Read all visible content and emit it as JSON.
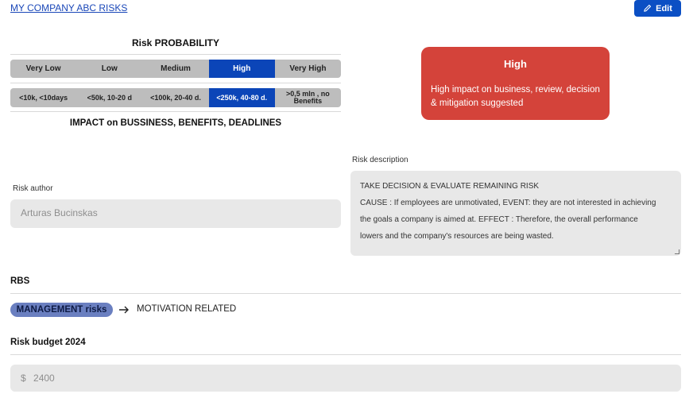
{
  "header": {
    "breadcrumb": "MY COMPANY ABC RISKS",
    "edit_label": "Edit"
  },
  "probability": {
    "title": "Risk PROBABILITY",
    "levels": [
      "Very Low",
      "Low",
      "Medium",
      "High",
      "Very High"
    ],
    "selected": "High"
  },
  "impact": {
    "levels": [
      "<10k, <10days",
      "<50k, 10-20 d",
      "<100k, 20-40 d.",
      "<250k, 40-80 d.",
      ">0,5 mln , no Benefits"
    ],
    "selected": "<250k, 40-80 d.",
    "title": "IMPACT on BUSSINESS, BENEFITS, DEADLINES"
  },
  "risk_card": {
    "title": "High",
    "text": "High impact on business, review, decision & mitigation suggested",
    "color": "#d4433a"
  },
  "author": {
    "label": "Risk author",
    "value": "Arturas Bucinskas"
  },
  "description": {
    "label": "Risk description",
    "lines": [
      "TAKE DECISION  & EVALUATE REMAINING RISK",
      "CAUSE : If employees are unmotivated, EVENT: they are not interested in achieving",
      "the goals a company is aimed at. EFFECT : Therefore, the overall performance",
      "lowers and the company's resources are being wasted."
    ]
  },
  "rbs": {
    "title": "RBS",
    "category": "MANAGEMENT risks",
    "subcategory": "MOTIVATION RELATED"
  },
  "budget": {
    "title": "Risk budget 2024",
    "currency": "$",
    "value": "2400"
  },
  "colors": {
    "accent": "#0b45b8",
    "segment_bg": "#bdbdbd",
    "field_bg": "#e8e8e8",
    "chip": "#6a7fc0"
  },
  "icons": {
    "edit": "pencil-icon",
    "arrow": "arrow-right-icon"
  }
}
